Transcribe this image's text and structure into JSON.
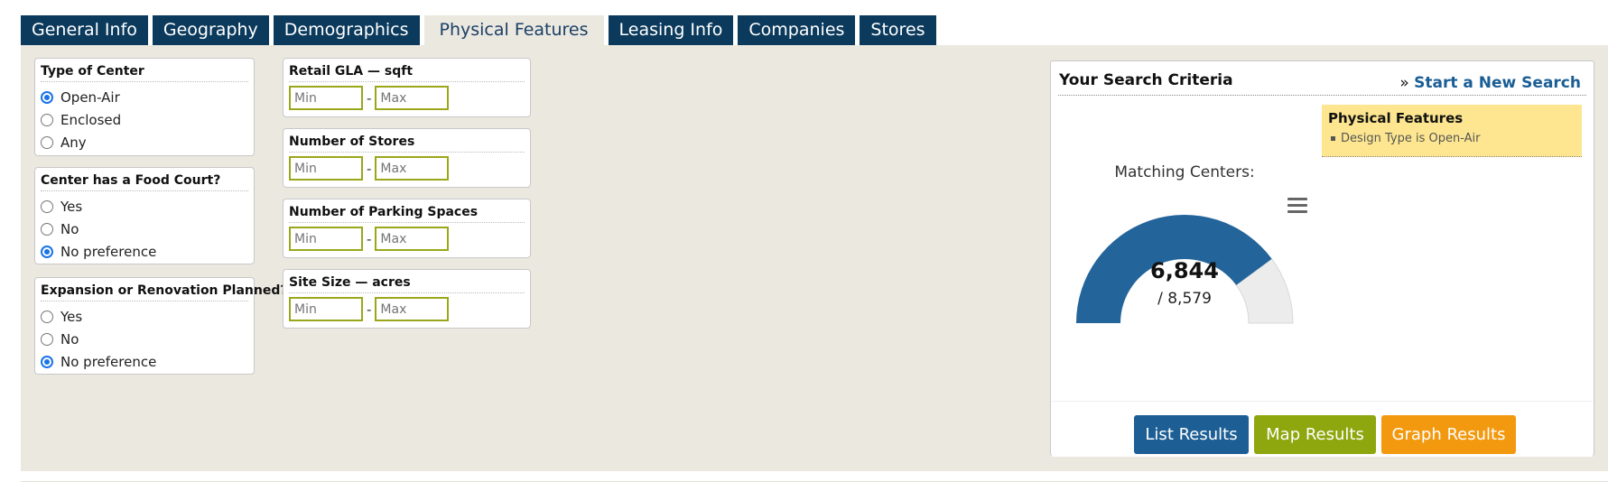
{
  "tabs": [
    "General Info",
    "Geography",
    "Demographics",
    "Physical Features",
    "Leasing Info",
    "Companies",
    "Stores"
  ],
  "active_tab": "Physical Features",
  "filters": {
    "type_of_center": {
      "title": "Type of Center",
      "options": [
        "Open-Air",
        "Enclosed",
        "Any"
      ],
      "selected": "Open-Air"
    },
    "food_court": {
      "title": "Center has a Food Court?",
      "options": [
        "Yes",
        "No",
        "No preference"
      ],
      "selected": "No preference"
    },
    "expansion": {
      "title": "Expansion or Renovation Planned?",
      "options": [
        "Yes",
        "No",
        "No preference"
      ],
      "selected": "No preference"
    }
  },
  "ranges": [
    {
      "title": "Retail GLA — sqft",
      "min_placeholder": "Min",
      "max_placeholder": "Max"
    },
    {
      "title": "Number of Stores",
      "min_placeholder": "Min",
      "max_placeholder": "Max"
    },
    {
      "title": "Number of Parking Spaces",
      "min_placeholder": "Min",
      "max_placeholder": "Max"
    },
    {
      "title": "Site Size — acres",
      "min_placeholder": "Min",
      "max_placeholder": "Max"
    }
  ],
  "range_separator": "-",
  "criteria": {
    "title": "Your Search Criteria",
    "new_search_prefix": "»",
    "new_search_link": "Start a New Search",
    "feature_group": "Physical Features",
    "feature_item": "Design Type is Open-Air",
    "matching_label": "Matching Centers:",
    "matching_value": "6,844",
    "matching_total": "/ 8,579",
    "matching_fraction": 0.7978,
    "gauge_color": "#23649a",
    "gauge_track_color": "#ececec"
  },
  "buttons": {
    "list": "List Results",
    "map": "Map Results",
    "graph": "Graph Results"
  },
  "colors": {
    "tab_bg": "#0b3a5c",
    "panel_bg": "#ebe8e0",
    "list_btn": "#1d5f94",
    "map_btn": "#8ea70f",
    "graph_btn": "#f2990f"
  }
}
